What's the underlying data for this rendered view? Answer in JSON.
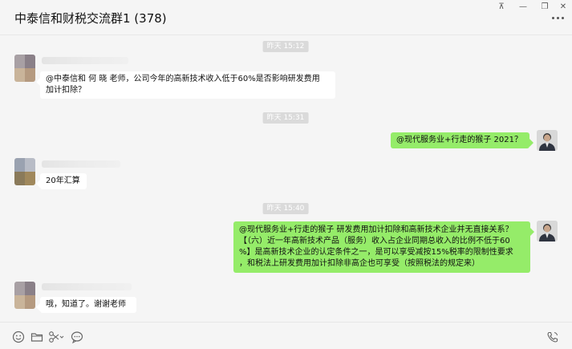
{
  "window": {
    "title": "中泰信和财税交流群1 (378)",
    "controls": {
      "pin": "⊼",
      "minimize": "—",
      "maximize": "❐",
      "close": "✕"
    }
  },
  "messages": [
    {
      "kind": "time",
      "text": "昨天 15:12"
    },
    {
      "kind": "in",
      "lines": [
        "@中泰信和 何 晓 老师，公司今年的高新技术收入低于60%是否影响研发费用",
        "加计扣除？"
      ]
    },
    {
      "kind": "time",
      "text": "昨天 15:31"
    },
    {
      "kind": "out",
      "lines": [
        "@现代服务业+行走的猴子 2021？"
      ]
    },
    {
      "kind": "in",
      "lines": [
        "20年汇算"
      ]
    },
    {
      "kind": "time",
      "text": "昨天 15:40"
    },
    {
      "kind": "out",
      "lines": [
        "@现代服务业+行走的猴子 研发费用加计扣除和高新技术企业并无直接关系？",
        "【（六）近一年高新技术产品（服务）收入占企业同期总收入的比例不低于60",
        "%】是高新技术企业的认定条件之一，是可以享受减按15%税率的限制性要求",
        "，和税法上研发费用加计扣除非高企也可享受（按照税法的规定来）"
      ]
    },
    {
      "kind": "in",
      "lines": [
        "哦，知道了。谢谢老师"
      ]
    }
  ],
  "toolbar": {
    "icons": [
      "emoji-icon",
      "folder-icon",
      "scissors-icon",
      "chat-history-icon",
      "voice-call-icon"
    ]
  },
  "colors": {
    "background": "#f5f5f5",
    "bubble_out": "#95ec69",
    "bubble_in": "#ffffff",
    "time_pill": "#dadada"
  }
}
